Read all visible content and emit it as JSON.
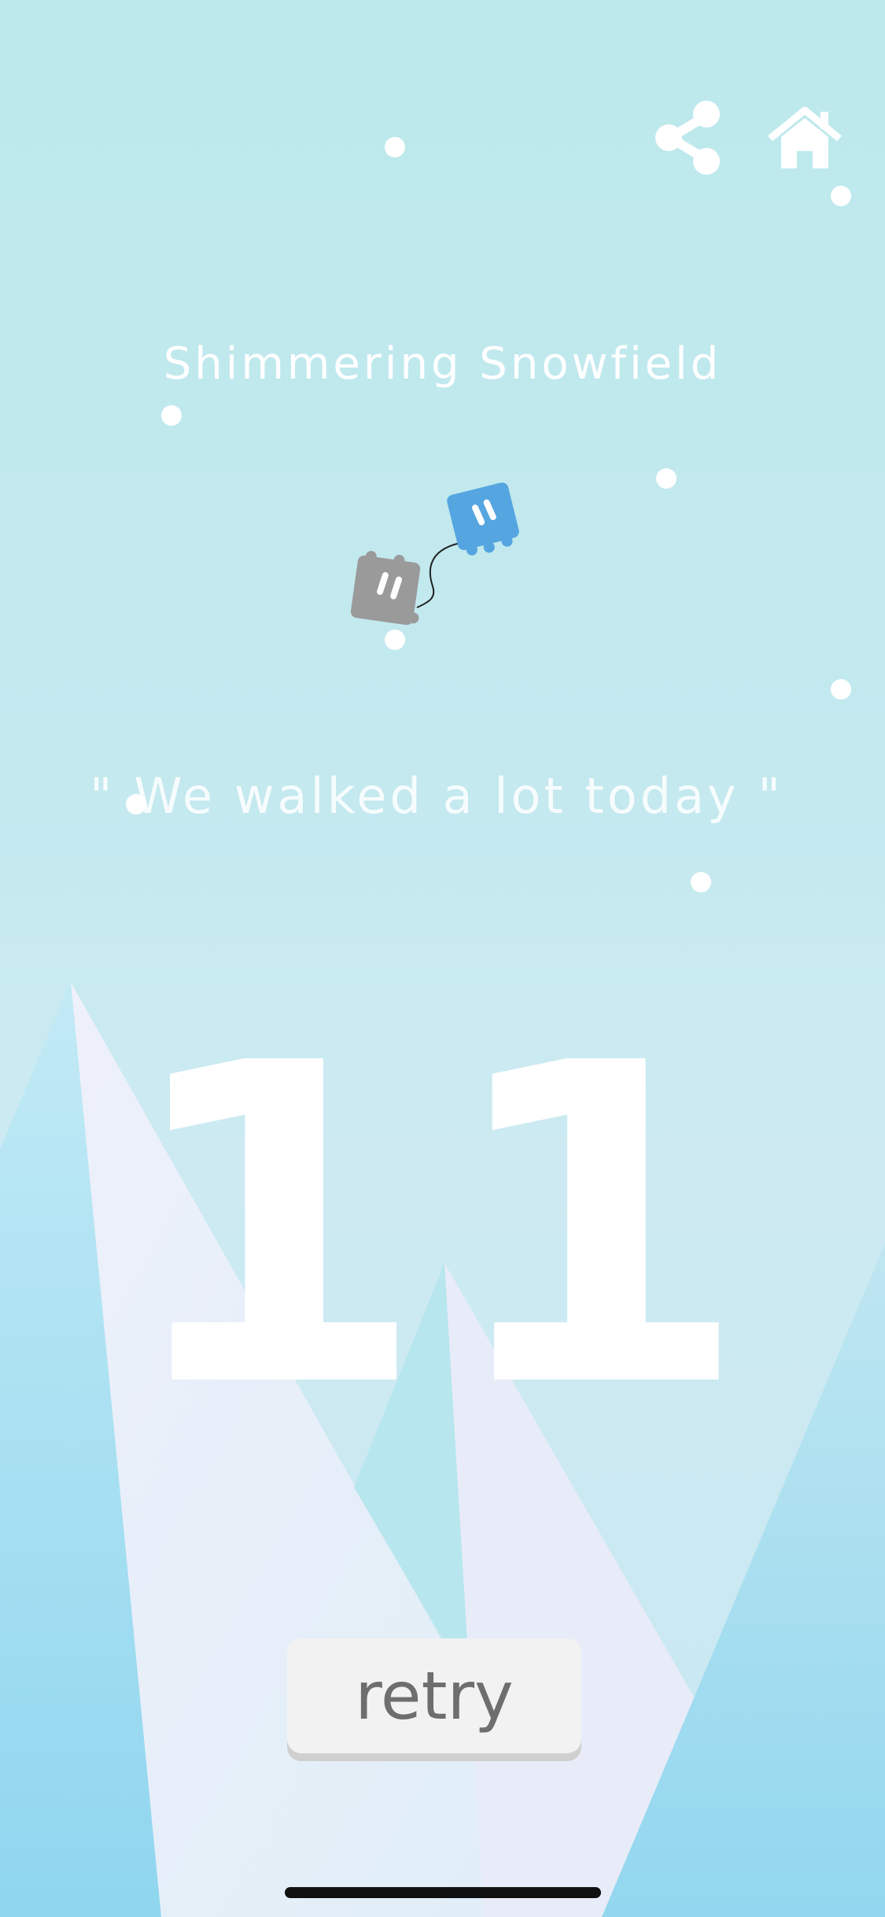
{
  "level": {
    "title": "Shimmering Snowfield",
    "quote": "\" We walked a lot today \""
  },
  "score": "11",
  "buttons": {
    "retry_label": "retry",
    "share_icon": "share-icon",
    "home_icon": "home-icon"
  },
  "characters": [
    {
      "name": "blue-cube",
      "color": "#55a5e0"
    },
    {
      "name": "gray-cube",
      "color": "#999999"
    }
  ],
  "colors": {
    "sky": "#bde9ec",
    "mountain_light": "#eceef9",
    "mountain_blue": "#a9dff2",
    "text": "#ffffff",
    "button": "#f2f2f2",
    "button_text": "#6e6e6e"
  }
}
